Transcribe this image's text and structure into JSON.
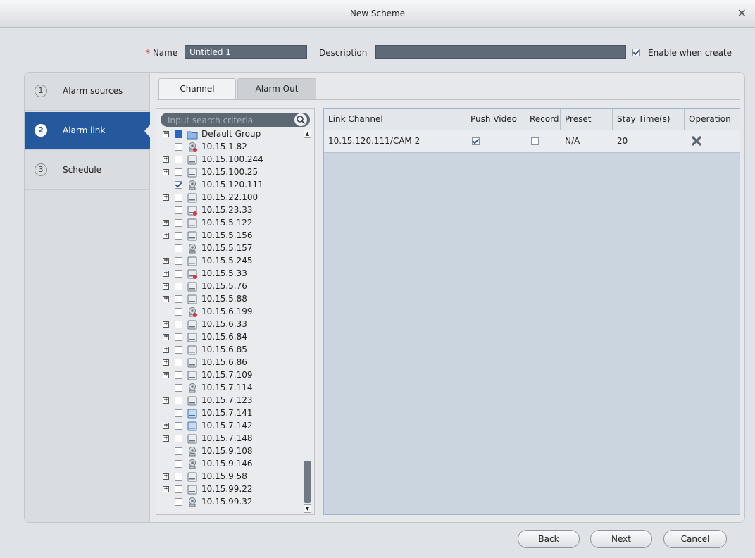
{
  "window": {
    "title": "New Scheme"
  },
  "header": {
    "name_label": "Name",
    "name_required_mark": "*",
    "name_value": "Untitled 1",
    "description_label": "Description",
    "description_value": "",
    "enable_label": "Enable when create",
    "enable_checked": true
  },
  "steps": [
    {
      "num": "1",
      "label": "Alarm sources",
      "active": false
    },
    {
      "num": "2",
      "label": "Alarm link",
      "active": true
    },
    {
      "num": "3",
      "label": "Schedule",
      "active": false
    }
  ],
  "tabs": [
    {
      "label": "Channel",
      "active": true
    },
    {
      "label": "Alarm Out",
      "active": false
    }
  ],
  "search": {
    "placeholder": "Input search criteria"
  },
  "tree": {
    "root": "Default Group",
    "items": [
      {
        "label": "10.15.1.82",
        "expandable": false,
        "checked": false,
        "icon": "camera-offline-icon"
      },
      {
        "label": "10.15.100.244",
        "expandable": true,
        "checked": false,
        "icon": "nvr-icon"
      },
      {
        "label": "10.15.100.25",
        "expandable": true,
        "checked": false,
        "icon": "nvr-icon"
      },
      {
        "label": "10.15.120.111",
        "expandable": false,
        "checked": true,
        "icon": "camera-icon"
      },
      {
        "label": "10.15.22.100",
        "expandable": true,
        "checked": false,
        "icon": "nvr-icon"
      },
      {
        "label": "10.15.23.33",
        "expandable": false,
        "checked": false,
        "icon": "nvr-offline-icon"
      },
      {
        "label": "10.15.5.122",
        "expandable": true,
        "checked": false,
        "icon": "nvr-icon"
      },
      {
        "label": "10.15.5.156",
        "expandable": true,
        "checked": false,
        "icon": "nvr-icon"
      },
      {
        "label": "10.15.5.157",
        "expandable": false,
        "checked": false,
        "icon": "camera-icon"
      },
      {
        "label": "10.15.5.245",
        "expandable": true,
        "checked": false,
        "icon": "nvr-icon"
      },
      {
        "label": "10.15.5.33",
        "expandable": true,
        "checked": false,
        "icon": "nvr-offline-icon"
      },
      {
        "label": "10.15.5.76",
        "expandable": true,
        "checked": false,
        "icon": "nvr-icon"
      },
      {
        "label": "10.15.5.88",
        "expandable": true,
        "checked": false,
        "icon": "nvr-icon"
      },
      {
        "label": "10.15.6.199",
        "expandable": false,
        "checked": false,
        "icon": "camera-offline-icon"
      },
      {
        "label": "10.15.6.33",
        "expandable": true,
        "checked": false,
        "icon": "nvr-icon"
      },
      {
        "label": "10.15.6.84",
        "expandable": true,
        "checked": false,
        "icon": "nvr-icon"
      },
      {
        "label": "10.15.6.85",
        "expandable": true,
        "checked": false,
        "icon": "nvr-icon"
      },
      {
        "label": "10.15.6.86",
        "expandable": true,
        "checked": false,
        "icon": "nvr-icon"
      },
      {
        "label": "10.15.7.109",
        "expandable": true,
        "checked": false,
        "icon": "nvr-icon"
      },
      {
        "label": "10.15.7.114",
        "expandable": false,
        "checked": false,
        "icon": "camera-icon"
      },
      {
        "label": "10.15.7.123",
        "expandable": true,
        "checked": false,
        "icon": "nvr-icon"
      },
      {
        "label": "10.15.7.141",
        "expandable": false,
        "checked": false,
        "icon": "nvr-blue-icon"
      },
      {
        "label": "10.15.7.142",
        "expandable": true,
        "checked": false,
        "icon": "nvr-blue-icon"
      },
      {
        "label": "10.15.7.148",
        "expandable": true,
        "checked": false,
        "icon": "nvr-icon"
      },
      {
        "label": "10.15.9.108",
        "expandable": false,
        "checked": false,
        "icon": "camera-icon"
      },
      {
        "label": "10.15.9.146",
        "expandable": false,
        "checked": false,
        "icon": "camera-icon"
      },
      {
        "label": "10.15.9.58",
        "expandable": true,
        "checked": false,
        "icon": "nvr-icon"
      },
      {
        "label": "10.15.99.22",
        "expandable": true,
        "checked": false,
        "icon": "nvr-icon"
      },
      {
        "label": "10.15.99.32",
        "expandable": false,
        "checked": false,
        "icon": "camera-icon"
      }
    ]
  },
  "table": {
    "columns": [
      "Link Channel",
      "Push Video",
      "Record",
      "Preset",
      "Stay Time(s)",
      "Operation"
    ],
    "rows": [
      {
        "channel": "10.15.120.111/CAM 2",
        "push_video": true,
        "record": false,
        "preset": "N/A",
        "stay_time": "20",
        "operation_icon": "delete-icon"
      }
    ]
  },
  "buttons": {
    "back": "Back",
    "next": "Next",
    "cancel": "Cancel"
  },
  "colors": {
    "accent": "#24599e",
    "input_bg": "#5f6a79",
    "delete_icon": "#5a6470"
  }
}
